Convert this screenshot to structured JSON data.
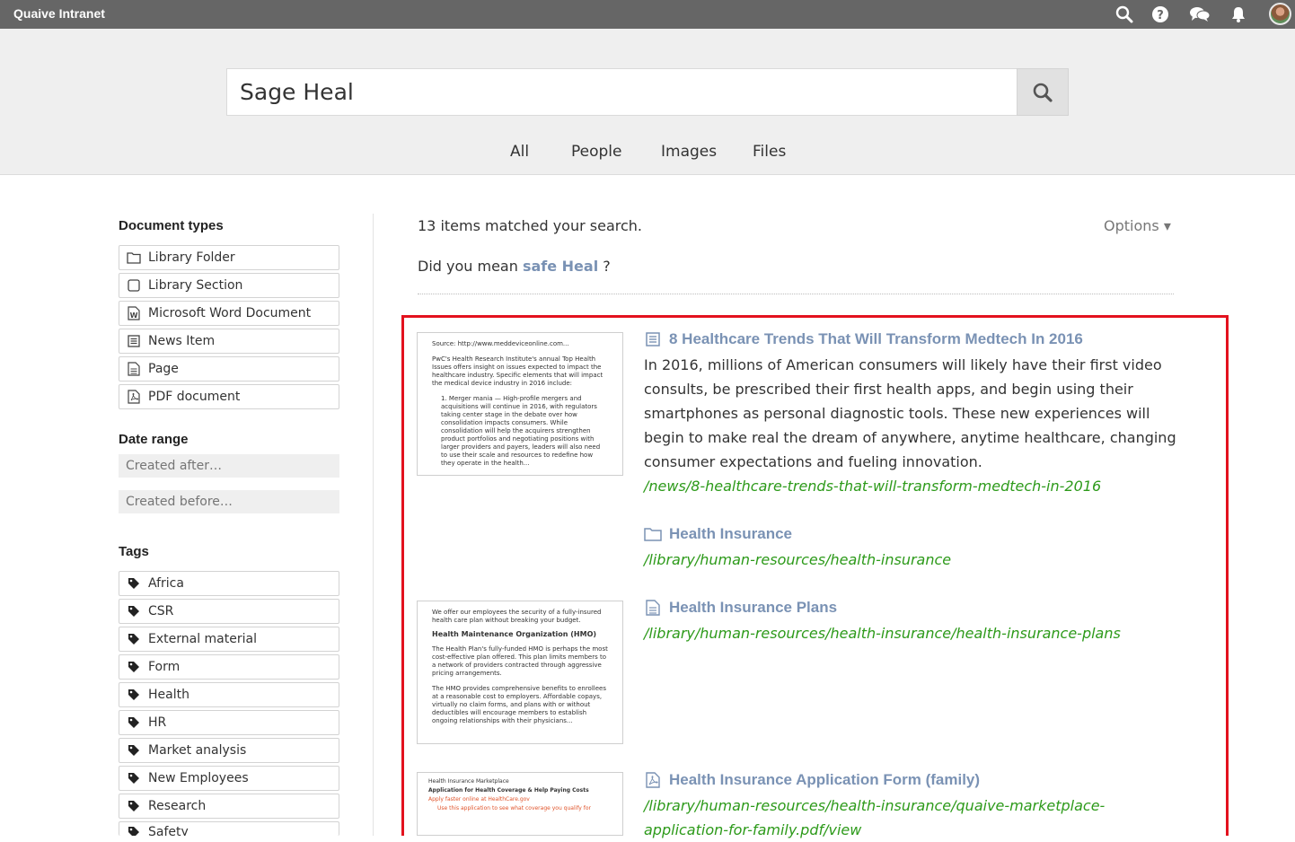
{
  "topbar": {
    "brand": "Quaive Intranet",
    "icons": [
      "search-icon",
      "help-icon",
      "chat-icon",
      "bell-icon",
      "avatar"
    ]
  },
  "search": {
    "query": "Sage Heal",
    "tabs": [
      "All",
      "People",
      "Images",
      "Files"
    ]
  },
  "sidebar": {
    "doc_types_heading": "Document types",
    "doc_types": [
      {
        "label": "Library Folder",
        "icon": "folder-icon"
      },
      {
        "label": "Library Section",
        "icon": "section-icon"
      },
      {
        "label": "Microsoft Word Document",
        "icon": "word-doc-icon"
      },
      {
        "label": "News Item",
        "icon": "news-icon"
      },
      {
        "label": "Page",
        "icon": "page-icon"
      },
      {
        "label": "PDF document",
        "icon": "pdf-icon"
      }
    ],
    "date_heading": "Date range",
    "created_after_placeholder": "Created after…",
    "created_before_placeholder": "Created before…",
    "tags_heading": "Tags",
    "tags": [
      "Africa",
      "CSR",
      "External material",
      "Form",
      "Health",
      "HR",
      "Market analysis",
      "New Employees",
      "Research",
      "Safety"
    ]
  },
  "results": {
    "count_text": "13 items matched your search.",
    "options_label": "Options ▾",
    "didyou_prefix": "Did you mean ",
    "didyou_link": "safe Heal",
    "didyou_suffix": " ?",
    "items": [
      {
        "title": "8 Healthcare Trends That Will Transform Medtech In 2016",
        "icon": "news-icon",
        "description": "In 2016, millions of American consumers will likely have their first video consults, be prescribed their first health apps, and begin using their smartphones as personal diagnostic tools. These new experiences will begin to make real the dream of anywhere, anytime healthcare, changing consumer expectations and fueling innovation.",
        "url": "/news/8-healthcare-trends-that-will-transform-medtech-in-2016",
        "thumb_lines": [
          "Source: http://www.meddeviceonline.com...",
          "PwC's Health Research Institute's annual Top Health Issues offers insight on issues expected to impact the healthcare industry. Specific elements that will impact the medical device industry in 2016 include:",
          "1. Merger mania — High-profile mergers and acquisitions will continue in 2016, with regulators taking center stage in the debate over how consolidation impacts consumers. While consolidation will help the acquirers strengthen product portfolios and negotiating positions with larger providers and payers, leaders will also need to use their scale and resources to redefine how they operate in the health..."
        ]
      },
      {
        "title": "Health Insurance",
        "icon": "folder-icon",
        "url": "/library/human-resources/health-insurance"
      },
      {
        "title": "Health Insurance Plans",
        "icon": "page-icon",
        "url": "/library/human-resources/health-insurance/health-insurance-plans",
        "thumb_lines": [
          "We offer our employees the security of a fully-insured health care plan without breaking your budget.",
          "Health Maintenance Organization (HMO)",
          "The Health Plan's fully-funded HMO is perhaps the most cost-effective plan offered. This plan limits members to a network of providers contracted through aggressive pricing arrangements.",
          "The HMO provides comprehensive benefits to enrollees at a reasonable cost to employers. Affordable copays, virtually no claim forms, and plans with or without deductibles will encourage members to establish ongoing relationships with their physicians..."
        ]
      },
      {
        "title": "Health Insurance Application Form (family)",
        "icon": "pdf-icon",
        "url": "/library/human-resources/health-insurance/quaive-marketplace-application-for-family.pdf/view",
        "thumb_lines": [
          "Health Insurance Marketplace",
          "Application for Health Coverage & Help Paying Costs",
          "Apply faster online at HealthCare.gov",
          "Use this application to see what coverage you qualify for"
        ]
      }
    ]
  },
  "colors": {
    "topbar": "#666666",
    "link": "#7a92b4",
    "url": "#2d9a1a",
    "highlight": "#e3121e"
  }
}
